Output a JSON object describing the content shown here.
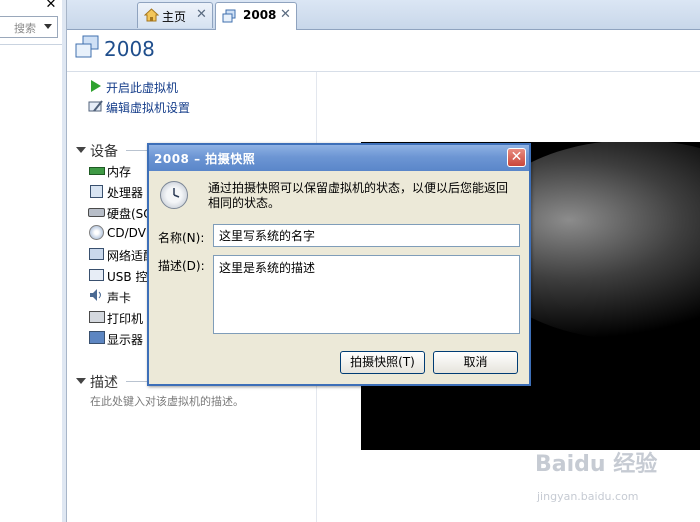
{
  "sidebar": {
    "close_glyph": "✕",
    "search_placeholder": "搜索"
  },
  "tabs": [
    {
      "label": "主页",
      "icon": "home-icon"
    },
    {
      "label": "2008",
      "icon": "vm-icon",
      "active": true
    }
  ],
  "vm": {
    "title": "2008",
    "actions": [
      "开启此虚拟机",
      "编辑虚拟机设置"
    ]
  },
  "devices": {
    "heading": "设备",
    "items": [
      {
        "label": "内存",
        "icon": "memory-icon"
      },
      {
        "label": "处理器",
        "icon": "cpu-icon"
      },
      {
        "label": "硬盘(SC",
        "icon": "disk-icon"
      },
      {
        "label": "CD/DVD",
        "icon": "cd-icon"
      },
      {
        "label": "网络适配",
        "icon": "network-icon"
      },
      {
        "label": "USB 控",
        "icon": "usb-icon"
      },
      {
        "label": "声卡",
        "icon": "sound-icon"
      },
      {
        "label": "打印机",
        "icon": "printer-icon"
      },
      {
        "label": "显示器",
        "icon": "display-icon"
      }
    ]
  },
  "description": {
    "heading": "描述",
    "hint": "在此处键入对该虚拟机的描述。"
  },
  "dialog": {
    "title": "2008 – 拍摄快照",
    "close_glyph": "✕",
    "info": "通过拍摄快照可以保留虚拟机的状态，以便以后您能返回相同的状态。",
    "name_label": "名称(N):",
    "name_value": "这里写系统的名字",
    "desc_label": "描述(D):",
    "desc_value": "这里是系统的描述",
    "snapshot_button": "拍摄快照(T)",
    "cancel_button": "取消"
  },
  "watermark": {
    "main": "Baidu 经验",
    "sub": "jingyan.baidu.com"
  },
  "colors": {
    "accent": "#1f4e8c",
    "dialog_title_bar": "#6d96d4",
    "link": "#153d8a"
  }
}
